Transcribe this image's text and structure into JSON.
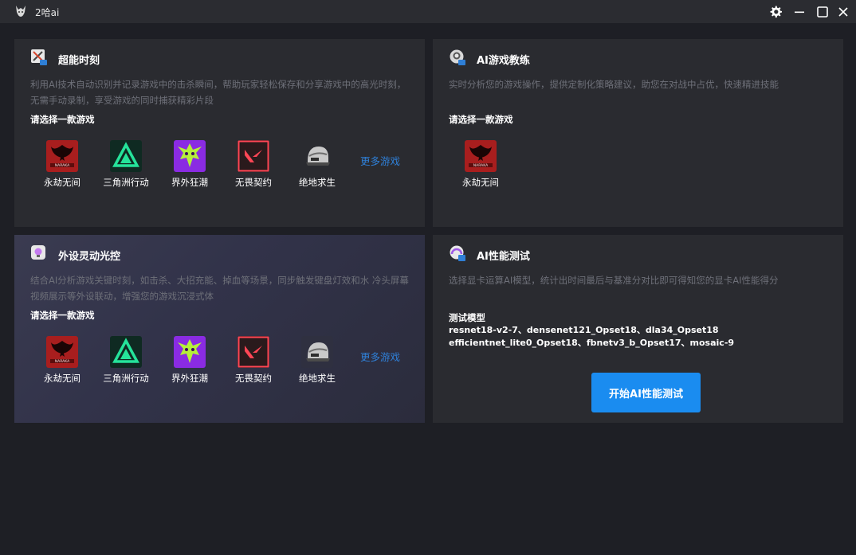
{
  "app": {
    "title": "2哈ai"
  },
  "cards": {
    "boost": {
      "title": "超能时刻",
      "desc": "利用AI技术自动识别并记录游戏中的击杀瞬间，帮助玩家轻松保存和分享游戏中的高光时刻，无需手动录制，享受游戏的同时捕获精彩片段",
      "prompt": "请选择一款游戏",
      "games": [
        "永劫无间",
        "三角洲行动",
        "界外狂潮",
        "无畏契约",
        "绝地求生"
      ],
      "more": "更多游戏"
    },
    "coach": {
      "title": "AI游戏教练",
      "desc": "实时分析您的游戏操作，提供定制化策略建议，助您在对战中占优，快速精进技能",
      "prompt": "请选择一款游戏",
      "games": [
        "永劫无间"
      ]
    },
    "lighting": {
      "title": "外设灵动光控",
      "desc": "结合AI分析游戏关键时刻，如击杀、大招充能、掉血等场景，同步触发键盘灯效和水 冷头屏幕视频展示等外设联动，增强您的游戏沉浸式体",
      "prompt": "请选择一款游戏",
      "games": [
        "永劫无间",
        "三角洲行动",
        "界外狂潮",
        "无畏契约",
        "绝地求生"
      ],
      "more": "更多游戏"
    },
    "perf": {
      "title": "AI性能测试",
      "desc": "选择显卡运算AI模型，统计出时间最后与基准分对比即可得知您的显卡AI性能得分",
      "model_label": "测试模型",
      "models": "resnet18-v2-7、densenet121_Opset18、dla34_Opset18 efficientnet_lite0_Opset18、fbnetv3_b_Opset17、mosaic-9",
      "start_button": "开始AI性能测试"
    }
  },
  "icons": {
    "naraka": "naraka-icon",
    "delta": "delta-force-icon",
    "outside": "outside-frenzy-icon",
    "valorant": "valorant-icon",
    "pubg": "pubg-helmet-icon"
  },
  "colors": {
    "accent": "#1a8cf0",
    "link": "#2f7fd6"
  }
}
